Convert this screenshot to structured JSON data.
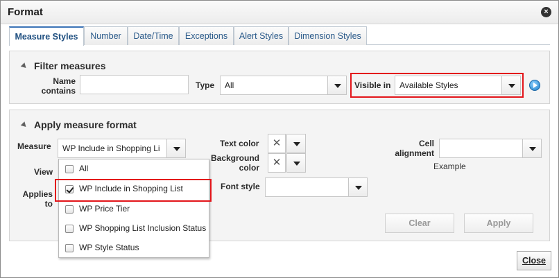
{
  "dialog": {
    "title": "Format",
    "close_glyph": "×"
  },
  "tabs": [
    "Measure Styles",
    "Number",
    "Date/Time",
    "Exceptions",
    "Alert Styles",
    "Dimension Styles"
  ],
  "filter": {
    "title": "Filter measures",
    "name_contains_label": "Name contains",
    "name_contains_value": "",
    "type_label": "Type",
    "type_value": "All",
    "visible_in_label": "Visible in",
    "visible_in_value": "Available Styles"
  },
  "apply": {
    "title": "Apply measure format",
    "measure_label": "Measure",
    "measure_value": "WP Include in Shopping Li",
    "view_label": "View",
    "applies_to_label": "Applies to",
    "text_color_label": "Text color",
    "background_color_label": "Background color",
    "font_style_label": "Font style",
    "font_style_value": "",
    "cell_alignment_label": "Cell alignment",
    "cell_alignment_value": "",
    "example_label": "Example",
    "clear_label": "Clear",
    "apply_label": "Apply",
    "color_none_glyph": "✕"
  },
  "measure_options": [
    {
      "label": "All",
      "checked": false
    },
    {
      "label": "WP Include in Shopping List",
      "checked": true
    },
    {
      "label": "WP Price Tier",
      "checked": false
    },
    {
      "label": "WP Shopping List Inclusion Status",
      "checked": false
    },
    {
      "label": "WP Style Status",
      "checked": false
    }
  ],
  "footer": {
    "close_label": "Close"
  },
  "colors": {
    "highlight": "#e3151a",
    "tab_accent": "#3b73b6",
    "link_text": "#2a5a8a"
  },
  "icons": {
    "info": "play-circle-icon",
    "dropdown": "chevron-down-icon",
    "collapse": "triangle-collapse-icon"
  }
}
